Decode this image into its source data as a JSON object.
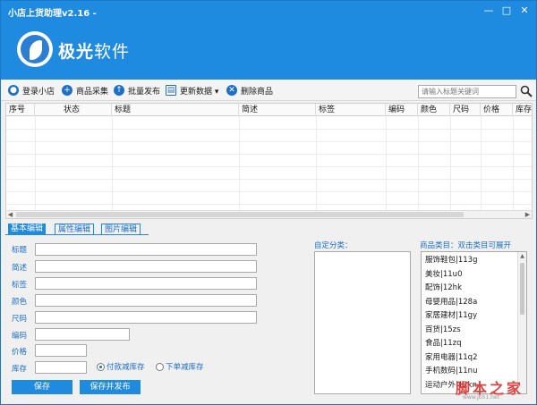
{
  "window": {
    "title": "小店上货助理v2.16 -",
    "minimize": "—",
    "maximize": "□",
    "close": "✕"
  },
  "brand": {
    "name_a": "极光",
    "name_b": "软件"
  },
  "toolbar": {
    "items": [
      {
        "label": "登录小店",
        "icon": "user-icon"
      },
      {
        "label": "商品采集",
        "icon": "plus-icon"
      },
      {
        "label": "批量发布",
        "icon": "upload-icon"
      },
      {
        "label": "更新数据 ▾",
        "icon": "table-icon"
      },
      {
        "label": "删除商品",
        "icon": "delete-icon"
      }
    ],
    "search_placeholder": "请输入标题关键词"
  },
  "table": {
    "columns": [
      "序号",
      "状态",
      "标题",
      "简述",
      "标签",
      "编码",
      "颜色",
      "尺码",
      "价格",
      "库存"
    ],
    "rows": []
  },
  "tabs": [
    "基本编辑",
    "属性编辑",
    "图片编辑"
  ],
  "form": {
    "fields": [
      {
        "label": "标题",
        "value": ""
      },
      {
        "label": "简述",
        "value": ""
      },
      {
        "label": "标签",
        "value": ""
      },
      {
        "label": "颜色",
        "value": ""
      },
      {
        "label": "尺码",
        "value": ""
      },
      {
        "label": "编码",
        "value": ""
      },
      {
        "label": "价格",
        "value": ""
      },
      {
        "label": "库存",
        "value": ""
      }
    ],
    "radio_options": [
      "付款减库存",
      "下单减库存"
    ],
    "radio_selected": 0,
    "save_label": "保存",
    "save_publish_label": "保存并发布"
  },
  "custom_category": {
    "label": "自定分类："
  },
  "category": {
    "label": "商品类目：双击类目可展开",
    "items": [
      "服饰鞋包|113g",
      "美妆|11u0",
      "配饰|12hk",
      "母婴用品|128a",
      "家居建材|11gy",
      "百货|15zs",
      "食品|11zq",
      "家用电器|11q2",
      "手机数码|11nu",
      "运动户外|12kn"
    ]
  },
  "watermark": {
    "text": "脚本之家",
    "url": "www.jb51.net"
  },
  "colors": {
    "accent": "#1e8ae0",
    "label": "#1d6fc8"
  }
}
